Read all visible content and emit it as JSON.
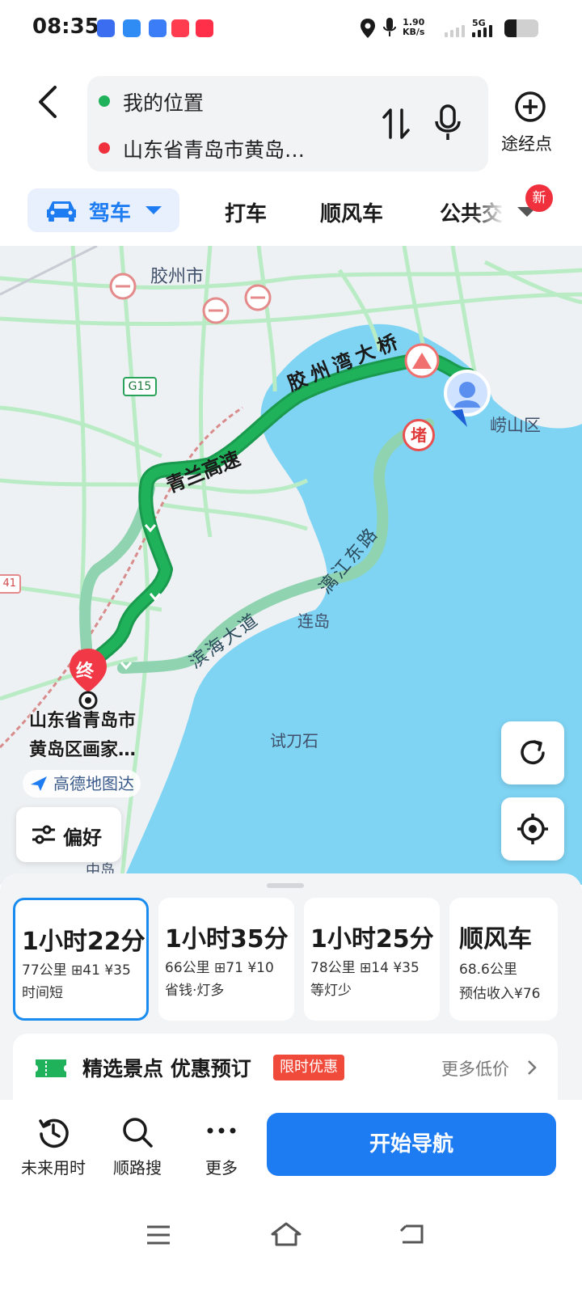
{
  "status_bar": {
    "time": "08:35",
    "net_speed_value": "1.90",
    "net_speed_unit": "KB/s",
    "network_type": "5G",
    "battery_level": 0.36
  },
  "header": {
    "origin": "我的位置",
    "destination": "山东省青岛市黄岛…",
    "waypoint_label": "途经点"
  },
  "modes": {
    "active": "驾车",
    "tabs": [
      "打车",
      "顺风车",
      "公共交"
    ],
    "new_badge": "新"
  },
  "map": {
    "labels": {
      "jiaozhou": "胶州市",
      "laoshan": "崂山区",
      "liandao": "连岛",
      "shidaoshi": "试刀石",
      "zhongdao": "中岛"
    },
    "road_labels": {
      "bridge": "胶州湾大桥",
      "qinglan": "青兰高速",
      "binhai": "滨海大道",
      "lijiang": "漓江东路"
    },
    "highway_shield": "G15",
    "edge_shield": "41",
    "jam_marker": "堵",
    "end_marker": "终",
    "destination_label": "山东省青岛市\n黄岛区画家…",
    "brand": "高德地图达",
    "preference_button": "偏好"
  },
  "routes": [
    {
      "time": "1小时22分",
      "distance": "77公里",
      "lights": "41",
      "cost": "¥35",
      "tag": "时间短",
      "selected": true
    },
    {
      "time": "1小时35分",
      "distance": "66公里",
      "lights": "71",
      "cost": "¥10",
      "tag": "省钱·灯多",
      "selected": false
    },
    {
      "time": "1小时25分",
      "distance": "78公里",
      "lights": "14",
      "cost": "¥35",
      "tag": "等灯少",
      "selected": false
    }
  ],
  "carpool_card": {
    "title": "顺风车",
    "distance": "68.6公里",
    "income": "预估收入¥76"
  },
  "promo": {
    "title": "精选景点 优惠预订",
    "badge": "限时优惠",
    "more": "更多低价"
  },
  "actions": {
    "future": "未来用时",
    "along": "顺路搜",
    "more": "更多",
    "start": "开始导航"
  },
  "colors": {
    "accent": "#1e7cf2",
    "route_green": "#1fb25a",
    "alt_route": "#8fd3b0",
    "sea": "#7fd4f4",
    "land": "#eef1f4"
  }
}
